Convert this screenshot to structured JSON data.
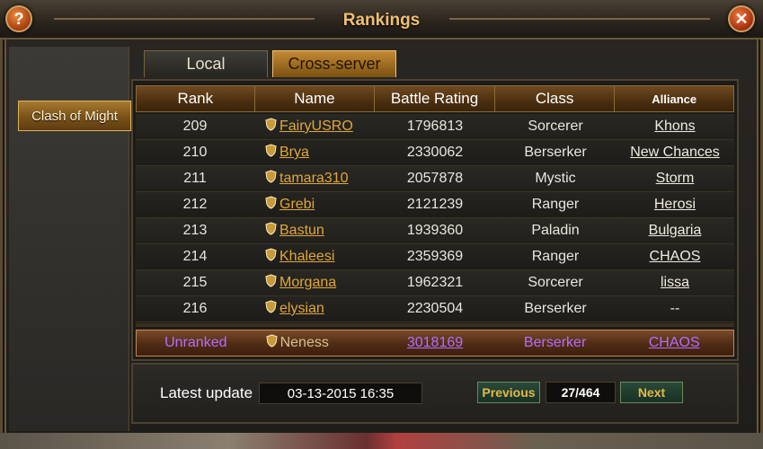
{
  "window": {
    "title": "Rankings"
  },
  "controls": {
    "help": "?",
    "close": "✕"
  },
  "tabs": [
    {
      "label": "Local"
    },
    {
      "label": "Cross-server"
    }
  ],
  "sidebar": {
    "selected": "Clash of Might"
  },
  "table": {
    "headers": [
      "Rank",
      "Name",
      "Battle Rating",
      "Class",
      "Alliance"
    ],
    "rows": [
      {
        "rank": "209",
        "name": "FairyUSRO",
        "br": "1796813",
        "class": "Sorcerer",
        "alliance": "Khons"
      },
      {
        "rank": "210",
        "name": "Brya",
        "br": "2330062",
        "class": "Berserker",
        "alliance": "New Chances"
      },
      {
        "rank": "211",
        "name": "tamara310",
        "br": "2057878",
        "class": "Mystic",
        "alliance": "Storm"
      },
      {
        "rank": "212",
        "name": "Grebi",
        "br": "2121239",
        "class": "Ranger",
        "alliance": "Herosi"
      },
      {
        "rank": "213",
        "name": "Bastun",
        "br": "1939360",
        "class": "Paladin",
        "alliance": "Bulgaria"
      },
      {
        "rank": "214",
        "name": "Khaleesi",
        "br": "2359369",
        "class": "Ranger",
        "alliance": "CHAOS"
      },
      {
        "rank": "215",
        "name": "Morgana",
        "br": "1962321",
        "class": "Sorcerer",
        "alliance": "lissa"
      },
      {
        "rank": "216",
        "name": "elysian",
        "br": "2230504",
        "class": "Berserker",
        "alliance": "--"
      }
    ],
    "self": {
      "rank": "Unranked",
      "name": "Neness",
      "br": "3018169",
      "class": "Berserker",
      "alliance": "CHAOS"
    }
  },
  "footer": {
    "latest_update_label": "Latest update",
    "latest_update_value": "03-13-2015 16:35",
    "previous_label": "Previous",
    "page": "27/464",
    "next_label": "Next"
  },
  "colors": {
    "accent": "#e0a83a",
    "self_row_text": "#b66cff",
    "title": "#f0c070"
  },
  "icons": [
    "help-icon",
    "close-icon",
    "shield-icon"
  ]
}
